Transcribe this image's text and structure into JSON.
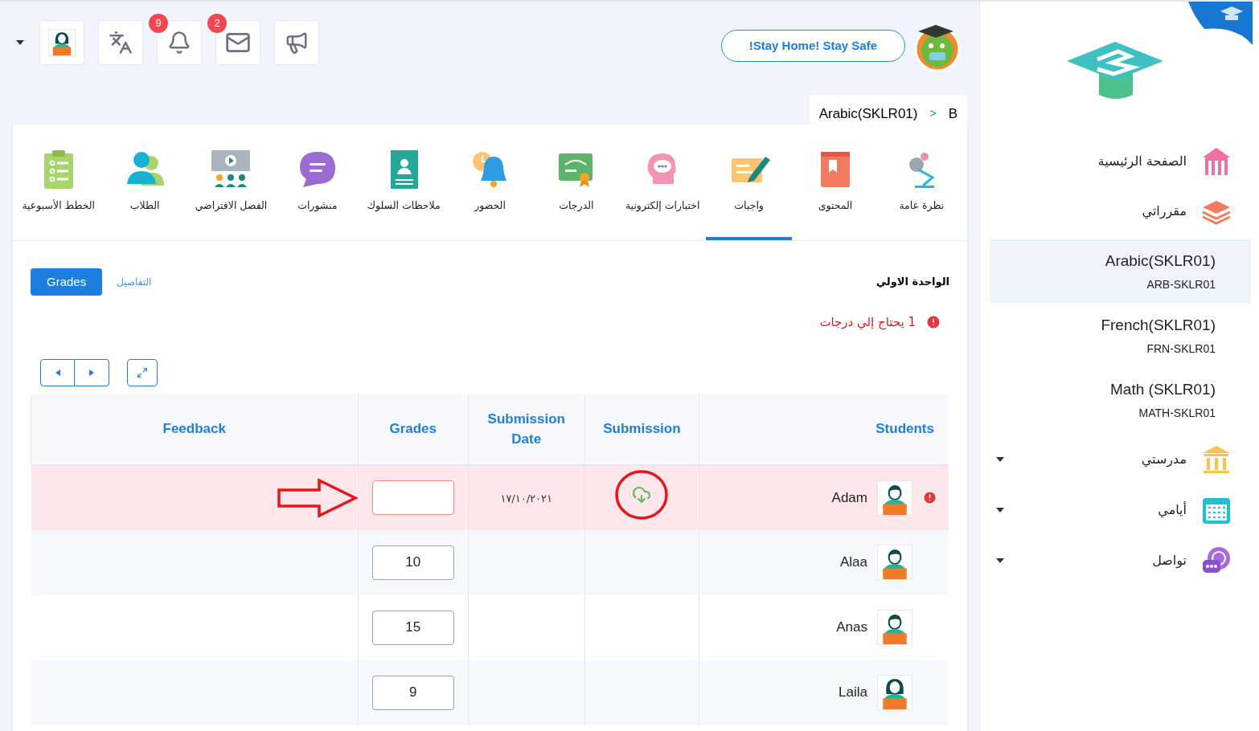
{
  "header": {
    "icon_buttons": [
      {
        "kind": "megaphone"
      },
      {
        "kind": "mail",
        "badge": "2"
      },
      {
        "kind": "bell",
        "badge": "9"
      },
      {
        "kind": "translate"
      },
      {
        "kind": "teacher"
      }
    ],
    "banner": "!Stay Home! Stay Safe",
    "breadcrumb": [
      "B",
      ">",
      "Arabic(SKLR01)"
    ]
  },
  "tabs": [
    {
      "label": "نظرة عامة",
      "kind": "overview",
      "selected": false
    },
    {
      "label": "المحتوى",
      "kind": "content",
      "selected": false
    },
    {
      "label": "واجبات",
      "kind": "homework",
      "selected": true
    },
    {
      "label": "اختبارات إلكترونية",
      "kind": "quiz",
      "selected": false
    },
    {
      "label": "الدرجات",
      "kind": "grades",
      "selected": false
    },
    {
      "label": "الحضور",
      "kind": "attendance",
      "selected": false
    },
    {
      "label": "ملاحظات السلوك",
      "kind": "behavior",
      "selected": false
    },
    {
      "label": "منشورات",
      "kind": "posts",
      "selected": false
    },
    {
      "label": "الفصل الافتراضي",
      "kind": "virtual",
      "selected": false
    },
    {
      "label": "الطلاب",
      "kind": "students",
      "selected": false
    },
    {
      "label": "الخطط الأسبوعية",
      "kind": "plans",
      "selected": false
    }
  ],
  "section": {
    "title": "الواحدة الاولي",
    "alert": "1 يحتاج إلي درجات",
    "views": [
      {
        "label": "التفاصيل",
        "selected": false
      },
      {
        "label": "Grades",
        "selected": true
      }
    ]
  },
  "table": {
    "columns": [
      "Students",
      "Submission",
      "Submission Date",
      "Grades",
      "Feedback"
    ],
    "rows": [
      {
        "student": "Adam",
        "kind": "male",
        "needs_grade": true,
        "annotated": true,
        "has_file": true,
        "date": "١٧/١٠/٢٠٢١"
      },
      {
        "student": "Alaa",
        "kind": "male",
        "needs_grade": false,
        "annotated": false,
        "has_file": false,
        "grade": "10"
      },
      {
        "student": "Anas",
        "kind": "male",
        "needs_grade": false,
        "annotated": false,
        "has_file": false,
        "grade": "15"
      },
      {
        "student": "Laila",
        "kind": "female",
        "needs_grade": false,
        "annotated": false,
        "has_file": false,
        "grade": "9"
      }
    ]
  },
  "sidebar": {
    "nav": [
      {
        "label": "الصفحة الرئيسية",
        "kind": "home"
      },
      {
        "label": "مقرراتي",
        "kind": "courses"
      }
    ],
    "courses": [
      {
        "name": "Arabic(SKLR01)",
        "code": "ARB-SKLR01",
        "selected": true
      },
      {
        "name": "French(SKLR01)",
        "code": "FRN-SKLR01",
        "selected": false
      },
      {
        "name": "Math (SKLR01)",
        "code": "MATH-SKLR01",
        "selected": false
      }
    ],
    "groups": [
      {
        "label": "مدرستي",
        "kind": "school",
        "expanded": false
      },
      {
        "label": "أيامي",
        "kind": "calendar",
        "expanded": false
      },
      {
        "label": "تواصل",
        "kind": "chat",
        "expanded": false
      }
    ]
  }
}
